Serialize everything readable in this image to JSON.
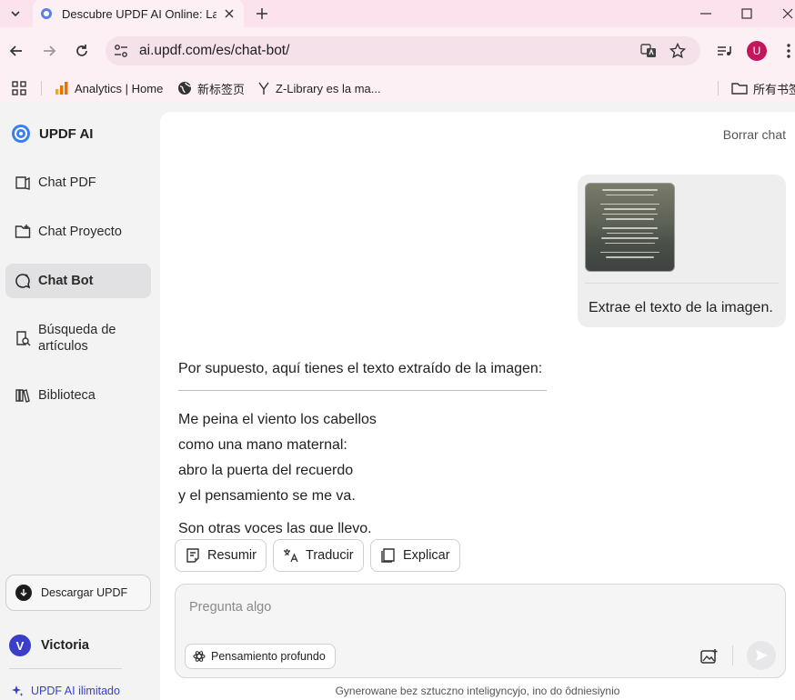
{
  "browser": {
    "tab_title": "Descubre UPDF AI Online: La",
    "url": "ai.updf.com/es/chat-bot/",
    "profile_initial": "U",
    "bookmarks": [
      {
        "label": "Analytics | Home",
        "icon": "analytics-icon"
      },
      {
        "label": "新标签页",
        "icon": "globe-icon"
      },
      {
        "label": "Z-Library es la ma...",
        "icon": "zlibrary-icon"
      }
    ],
    "all_bookmarks_label": "所有书签"
  },
  "sidebar": {
    "brand": "UPDF AI",
    "items": [
      {
        "label": "Chat PDF",
        "icon": "chat-pdf-icon"
      },
      {
        "label": "Chat Proyecto",
        "icon": "folder-icon"
      },
      {
        "label": "Chat Bot",
        "icon": "chat-bot-icon",
        "active": true
      },
      {
        "label": "Búsqueda de artículos",
        "icon": "article-search-icon"
      },
      {
        "label": "Biblioteca",
        "icon": "library-icon"
      }
    ],
    "download_label": "Descargar UPDF",
    "user": {
      "initial": "V",
      "name": "Victoria"
    },
    "unlimited_label": "UPDF AI ilimitado"
  },
  "chat": {
    "clear_label": "Borrar chat",
    "user_message": {
      "image": "poem-image-thumbnail",
      "text": "Extrae el texto de la imagen."
    },
    "bot_message": {
      "intro": "Por supuesto, aquí tienes el texto extraído de la imagen:",
      "lines": [
        "Me peina el viento los cabellos",
        "como una mano maternal:",
        "abro la puerta del recuerdo",
        "y el pensamiento se me va.",
        "Son otras voces las que llevo."
      ]
    },
    "actions": [
      {
        "label": "Resumir",
        "icon": "summarize-icon"
      },
      {
        "label": "Traducir",
        "icon": "translate-icon"
      },
      {
        "label": "Explicar",
        "icon": "explain-icon"
      }
    ],
    "composer": {
      "placeholder": "Pregunta algo",
      "deep_think_label": "Pensamiento profundo"
    },
    "disclaimer": "Gynerowane bez sztuczno inteligyncyjo, ino do ôdniesiynio"
  },
  "colors": {
    "accent": "#3a3ec9",
    "tabbar": "#fbe2ec",
    "chrome": "#fdf0f5"
  }
}
